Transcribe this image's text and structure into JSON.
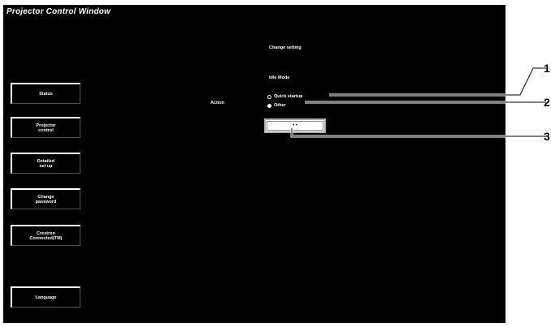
{
  "window": {
    "title": "Projector Control Window"
  },
  "sidebar": {
    "items": [
      {
        "label_lines": [
          "Status"
        ]
      },
      {
        "label_lines": [
          "Projector",
          "control"
        ]
      },
      {
        "label_lines": [
          "Detailed",
          "set up"
        ]
      },
      {
        "label_lines": [
          "Change",
          "password"
        ]
      },
      {
        "label_lines": [
          "Crestron",
          "Connected(TM)"
        ]
      },
      {
        "label_lines": [
          "Language"
        ]
      }
    ]
  },
  "main": {
    "heading": "Change setting",
    "subheading": "Idle Mode",
    "setting_label": "Action",
    "options": [
      {
        "label": "Quick startup",
        "checked": false
      },
      {
        "label": "Other",
        "checked": true
      }
    ],
    "apply_label": "• •"
  },
  "callouts": [
    "1",
    "2",
    "3"
  ]
}
